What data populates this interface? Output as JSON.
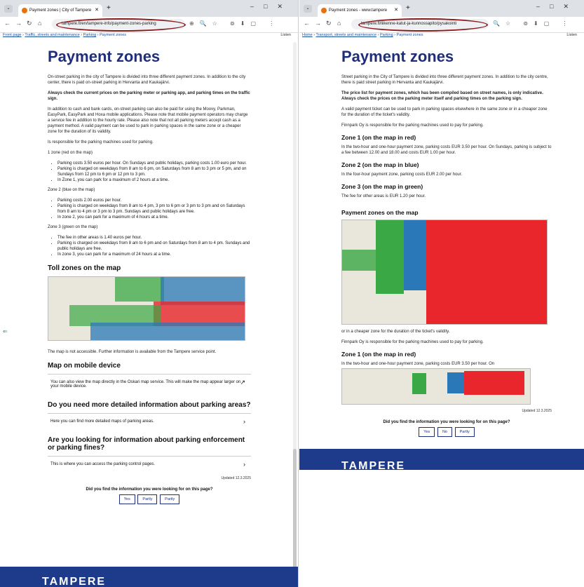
{
  "left_window": {
    "tab_title": "Payment zones | City of Tampere",
    "address": "tampere.fi/en/tampere-info/payment-zones-parking",
    "breadcrumb": [
      "Front page",
      "Traffic, streets and maintenance",
      "Parking",
      "Payment zones"
    ],
    "lang": "Listen",
    "page_title": "Payment zones",
    "intro": "On-street parking in the city of Tampere is divided into three different payment zones. In addition to the city center, there is paid on-street parking in Hervanta and Kaukajärvi.",
    "notice": "Always check the current prices on the parking meter or parking app, and parking times on the traffic sign.",
    "para2": "In addition to cash and bank cards, on-street parking can also be paid for using the Moovy, Parkman, EasyPark, EasyPark and Hoxa mobile applications. Please note that mobile payment operators may charge a service fee in addition to the hourly rate. Please also note that not all parking meters accept cash as a payment method. A valid payment can be used to park in parking spaces in the same zone or a cheaper zone for the duration of its validity.",
    "para3": "Is responsible for the parking machines used for parking.",
    "zone1_head": "1 zone (red on the map)",
    "zone1_items": [
      "Parking costs 3.50 euros per hour. On Sundays and public holidays, parking costs 1.00 euro per hour.",
      "Parking is charged on weekdays from 8 am to 6 pm, on Saturdays from 8 am to 3 pm or 5 pm, and on Sundays from 12 pm to 6 pm or 12 pm to 3 pm.",
      "In Zone 1, you can park for a maximum of 2 hours at a time."
    ],
    "zone2_head": "Zone 2 (blue on the map)",
    "zone2_items": [
      "Parking costs 2.00 euros per hour.",
      "Parking is charged on weekdays from 8 am to 4 pm, 3 pm to 6 pm or 3 pm to 3 pm and on Saturdays from 8 am to 4 pm or 3 pm to 3 pm. Sundays and public holidays are free.",
      "In zone 2, you can park for a maximum of 4 hours at a time."
    ],
    "zone3_head": "Zone 3 (green on the map)",
    "zone3_items": [
      "The fee in other areas is 1.40 euros per hour.",
      "Parking is charged on weekdays from 8 am to 6 pm and on Saturdays from 8 am to 4 pm. Sundays and public holidays are free.",
      "In zone 3, you can park for a maximum of 24 hours at a time."
    ],
    "toll_heading": "Toll zones on the map",
    "map_note": "The map is not accessible. Further information is available from the Tampere service point.",
    "mobile_heading": "Map on mobile device",
    "mobile_text": "You can also view the map directly in the Oskari map service. This will make the map appear larger on your mobile device.",
    "detail_heading": "Do you need more detailed information about parking areas?",
    "detail_text": "Here you can find more detailed maps of parking areas.",
    "enforce_heading": "Are you looking for information about parking enforcement or parking fines?",
    "enforce_text": "This is where you can access the parking control pages.",
    "updated": "Updated 12.3.2025",
    "feedback_q": "Did you find the information you were looking for on this page?",
    "feedback_btns": [
      "Yes",
      "Partly",
      "Partly"
    ],
    "footer": "TAMPERE"
  },
  "right_window": {
    "tab_title": "Payment zones - www.tampere",
    "address": "tampere.fi/liikenne-katut-ja-kunnossapito/pysakointi",
    "breadcrumb": [
      "Home",
      "Transport, streets and maintenance",
      "Parking",
      "Payment zones"
    ],
    "lang": "Listen",
    "page_title": "Payment zones",
    "intro": "Street parking in the City of Tampere is divided into three different payment zones. In addition to the city centre, there is paid street parking in Hervanta and Kaukajärvi.",
    "notice": "The price list for payment zones, which has been compiled based on street names, is only indicative. Always check the prices on the parking meter itself and parking times on the parking sign.",
    "para2": "A valid payment ticket can be used to park in parking spaces elsewhere in the same zone or in a cheaper zone for the duration of the ticket's validity.",
    "para3": "Finnpark Oy is responsible for the parking machines used to pay for parking.",
    "z1_heading": "Zone 1 (on the map in red)",
    "z1_text": "In the two-hour and one-hour payment zone, parking costs EUR 3.50 per hour. On Sundays, parking is subject to a fee between 12.00 and 18.00 and costs EUR 1.00 per hour.",
    "z2_heading": "Zone 2 (on the map in blue)",
    "z2_text": "In the four-hour payment zone, parking costs EUR 2.00 per hour.",
    "z3_heading": "Zone 3 (on the map in green)",
    "z3_text": "The fee for other areas is EUR 1.20 per hour.",
    "map_heading": "Payment zones on the map",
    "map_caption": "or in a cheaper zone for the duration of the ticket's validity.",
    "para_repeat": "Finnpark Oy is responsible for the parking machines used to pay for parking.",
    "z1_heading_repeat": "Zone 1 (on the map in red)",
    "z1_text_repeat": "In the two-hour and one-hour payment zone, parking costs EUR 3.50 per hour. On",
    "updated": "Updated 12.3.2025",
    "feedback_q": "Did you find the information you were looking for on this page?",
    "feedback_btns": [
      "Yes",
      "No",
      "Partly"
    ],
    "footer": "TAMPERE"
  },
  "colors": {
    "zone_red": "#e8262b",
    "zone_blue": "#2a78b8",
    "zone_green": "#3aa845",
    "brand": "#1f2e7a",
    "footer": "#1e3a8a",
    "annotation": "#8b1a1a"
  }
}
